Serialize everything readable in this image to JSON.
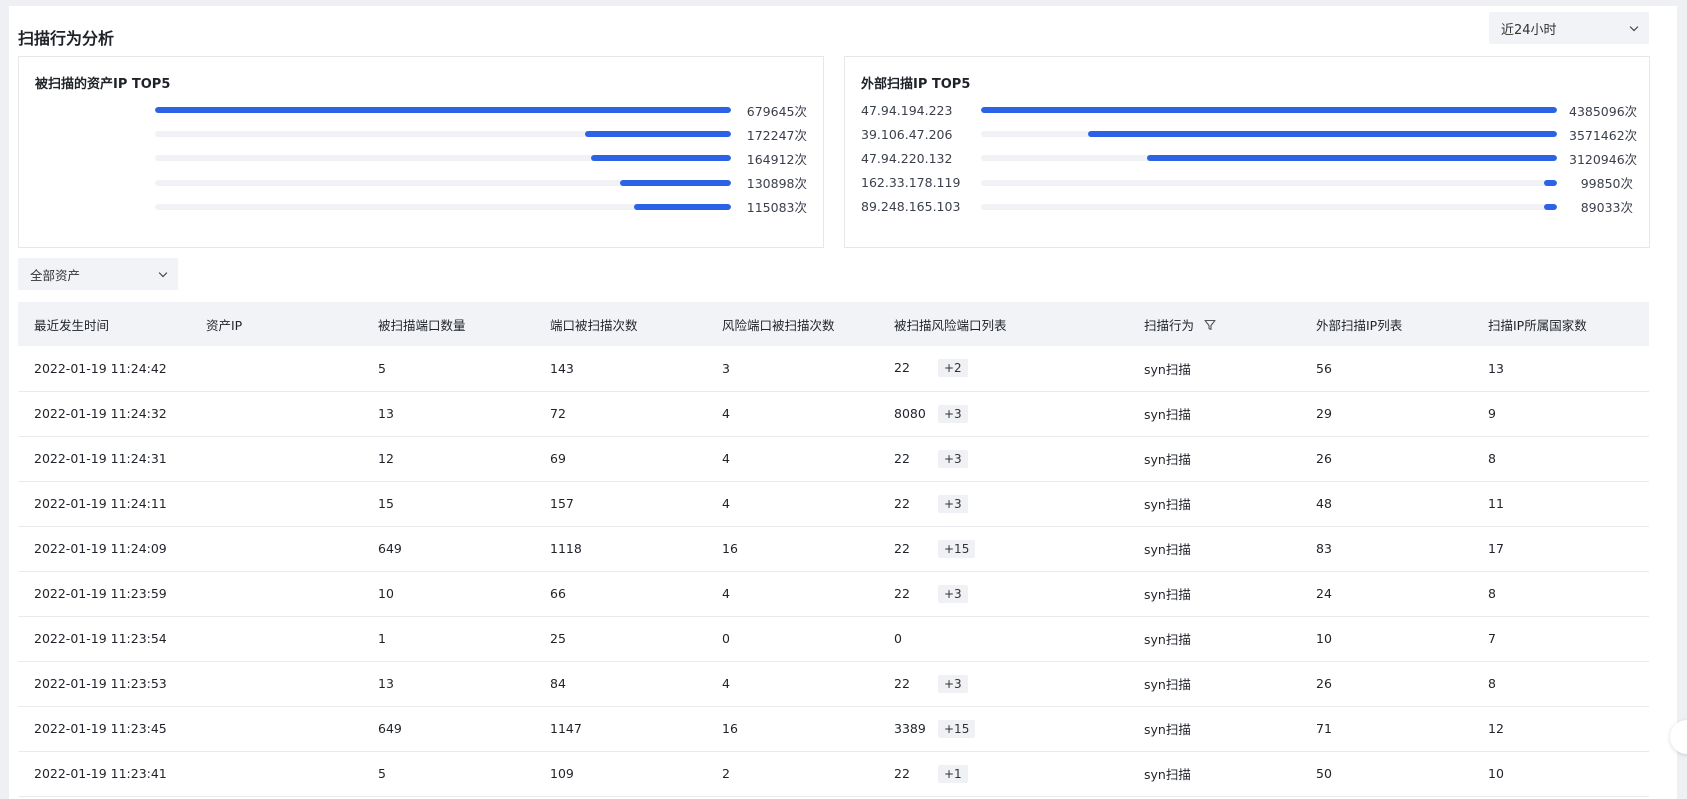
{
  "header": {
    "title": "扫描行为分析",
    "time_range": "近24小时"
  },
  "scanned_assets_top5": {
    "title": "被扫描的资产IP TOP5",
    "items": [
      {
        "label": "",
        "value": 679645,
        "value_text": "679645次",
        "fill": 1.0
      },
      {
        "label": "",
        "value": 172247,
        "value_text": "172247次",
        "fill": 0.253
      },
      {
        "label": "",
        "value": 164912,
        "value_text": "164912次",
        "fill": 0.243
      },
      {
        "label": "",
        "value": 130898,
        "value_text": "130898次",
        "fill": 0.193
      },
      {
        "label": "",
        "value": 115083,
        "value_text": "115083次",
        "fill": 0.169
      }
    ]
  },
  "external_scan_top5": {
    "title": "外部扫描IP TOP5",
    "items": [
      {
        "label": "47.94.194.223",
        "value": 4385096,
        "value_text": "4385096次",
        "fill": 1.0
      },
      {
        "label": "39.106.47.206",
        "value": 3571462,
        "value_text": "3571462次",
        "fill": 0.814
      },
      {
        "label": "47.94.220.132",
        "value": 3120946,
        "value_text": "3120946次",
        "fill": 0.712
      },
      {
        "label": "162.33.178.119",
        "value": 99850,
        "value_text": "99850次",
        "fill": 0.023
      },
      {
        "label": "89.248.165.103",
        "value": 89033,
        "value_text": "89033次",
        "fill": 0.02
      }
    ]
  },
  "asset_filter": {
    "selected": "全部资产"
  },
  "table": {
    "columns": [
      "最近发生时间",
      "资产IP",
      "被扫描端口数量",
      "端口被扫描次数",
      "风险端口被扫描次数",
      "被扫描风险端口列表",
      "扫描行为",
      "外部扫描IP列表",
      "扫描IP所属国家数"
    ],
    "rows": [
      {
        "time": "2022-01-19 11:24:42",
        "ip": "",
        "ports": "5",
        "port_hits": "143",
        "risk_hits": "3",
        "risk_port": "22",
        "risk_more": "+2",
        "behavior": "syn扫描",
        "ext_ips": "56",
        "countries": "13"
      },
      {
        "time": "2022-01-19 11:24:32",
        "ip": "",
        "ports": "13",
        "port_hits": "72",
        "risk_hits": "4",
        "risk_port": "8080",
        "risk_more": "+3",
        "behavior": "syn扫描",
        "ext_ips": "29",
        "countries": "9"
      },
      {
        "time": "2022-01-19 11:24:31",
        "ip": "",
        "ports": "12",
        "port_hits": "69",
        "risk_hits": "4",
        "risk_port": "22",
        "risk_more": "+3",
        "behavior": "syn扫描",
        "ext_ips": "26",
        "countries": "8"
      },
      {
        "time": "2022-01-19 11:24:11",
        "ip": "",
        "ports": "15",
        "port_hits": "157",
        "risk_hits": "4",
        "risk_port": "22",
        "risk_more": "+3",
        "behavior": "syn扫描",
        "ext_ips": "48",
        "countries": "11"
      },
      {
        "time": "2022-01-19 11:24:09",
        "ip": "",
        "ports": "649",
        "port_hits": "1118",
        "risk_hits": "16",
        "risk_port": "22",
        "risk_more": "+15",
        "behavior": "syn扫描",
        "ext_ips": "83",
        "countries": "17"
      },
      {
        "time": "2022-01-19 11:23:59",
        "ip": "",
        "ports": "10",
        "port_hits": "66",
        "risk_hits": "4",
        "risk_port": "22",
        "risk_more": "+3",
        "behavior": "syn扫描",
        "ext_ips": "24",
        "countries": "8"
      },
      {
        "time": "2022-01-19 11:23:54",
        "ip": "",
        "ports": "1",
        "port_hits": "25",
        "risk_hits": "0",
        "risk_port": "0",
        "risk_more": "",
        "behavior": "syn扫描",
        "ext_ips": "10",
        "countries": "7"
      },
      {
        "time": "2022-01-19 11:23:53",
        "ip": "",
        "ports": "13",
        "port_hits": "84",
        "risk_hits": "4",
        "risk_port": "22",
        "risk_more": "+3",
        "behavior": "syn扫描",
        "ext_ips": "26",
        "countries": "8"
      },
      {
        "time": "2022-01-19 11:23:45",
        "ip": "",
        "ports": "649",
        "port_hits": "1147",
        "risk_hits": "16",
        "risk_port": "3389",
        "risk_more": "+15",
        "behavior": "syn扫描",
        "ext_ips": "71",
        "countries": "12"
      },
      {
        "time": "2022-01-19 11:23:41",
        "ip": "",
        "ports": "5",
        "port_hits": "109",
        "risk_hits": "2",
        "risk_port": "22",
        "risk_more": "+1",
        "behavior": "syn扫描",
        "ext_ips": "50",
        "countries": "10"
      }
    ]
  },
  "icons": {
    "dropdown": "chevron-down-icon",
    "filter": "filter-icon"
  },
  "colors": {
    "bar": "#2b62e6",
    "track": "#f1f2f6",
    "header_bg": "#f2f3f7"
  }
}
